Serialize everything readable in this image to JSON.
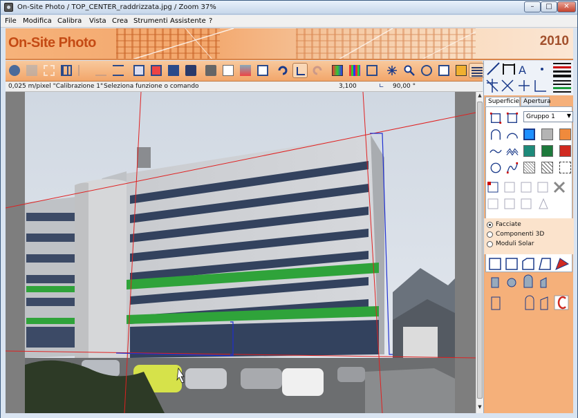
{
  "window": {
    "title": "On-Site Photo / TOP_CENTER_raddrizzata.jpg / Zoom 37%",
    "min": "–",
    "max": "□",
    "close": "✕"
  },
  "menu": [
    "File",
    "Modifica",
    "Calibra",
    "Vista",
    "Crea",
    "Strumenti",
    "Assistente",
    "?"
  ],
  "banner": {
    "logo": "On-Site Photo",
    "year": "2010"
  },
  "toolbar": {
    "buttons": [
      "start",
      "image",
      "crop",
      "grid",
      "align",
      "level",
      "distribute",
      "box-3d",
      "box-front",
      "box-side",
      "save",
      "print",
      "document",
      "gallery",
      "export",
      "undo",
      "angle-tool",
      "redo",
      "palette",
      "palette2",
      "move",
      "sparkle",
      "zoom",
      "view",
      "square",
      "fill",
      "layers"
    ]
  },
  "status": {
    "scale": "0,025 m/pixel \"Calibrazione 1\"",
    "message": "Seleziona funzione o comando",
    "value": "3,100",
    "angle": "90,00 °"
  },
  "panel": {
    "tabs": [
      "Superficie",
      "Apertura"
    ],
    "group": "Gruppo 1",
    "radios": [
      "Facciate",
      "Componenti 3D",
      "Moduli Solar"
    ],
    "selected_radio": "Facciate"
  },
  "colors": {
    "accent": "#f2a66a",
    "red_line": "#e02020",
    "blue_line": "#2030d0",
    "swatches": [
      "#1e90ff",
      "#b4b4b4",
      "#f08a3c",
      "#1e8a7a",
      "#1e7a3c",
      "#d02a20"
    ]
  }
}
